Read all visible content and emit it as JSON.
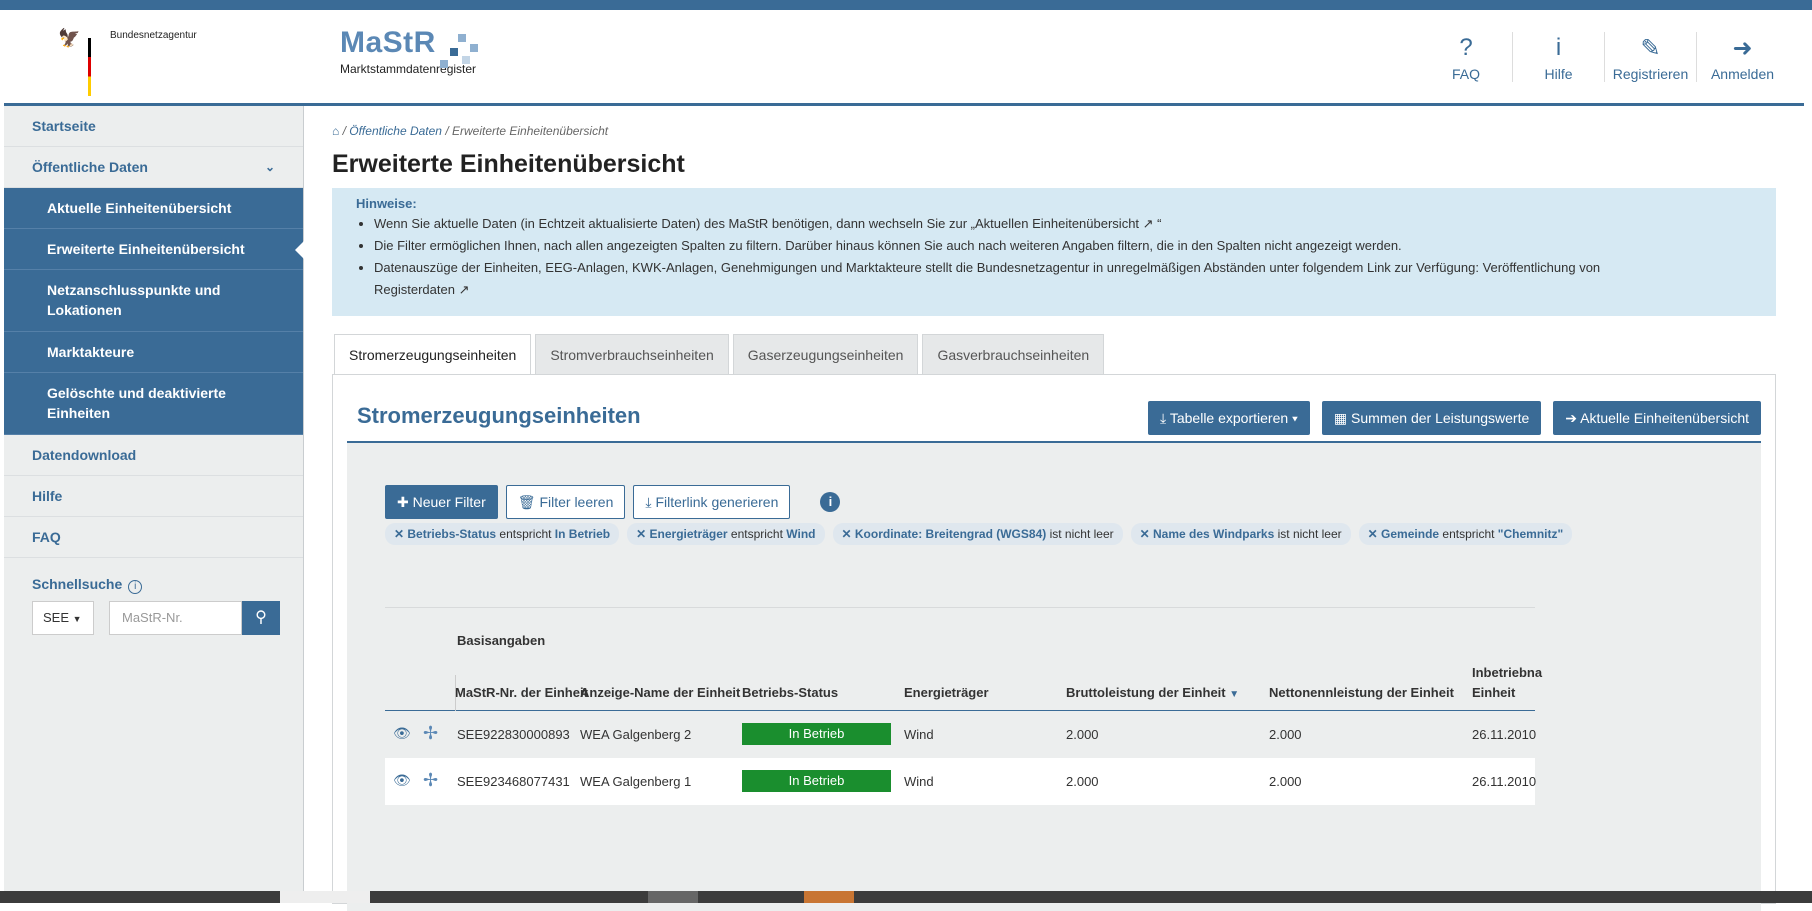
{
  "header": {
    "agency": "Bundesnetzagentur",
    "logo_title": "MaStR",
    "logo_sub": "Marktstammdatenregister",
    "nav": [
      {
        "icon": "question-circle-icon",
        "glyph": "?",
        "label": "FAQ"
      },
      {
        "icon": "info-circle-icon",
        "glyph": "i",
        "label": "Hilfe"
      },
      {
        "icon": "edit-icon",
        "glyph": "✎",
        "label": "Registrieren"
      },
      {
        "icon": "sign-in-icon",
        "glyph": "➜",
        "label": "Anmelden"
      }
    ]
  },
  "sidebar": {
    "items": [
      {
        "label": "Startseite"
      },
      {
        "label": "Öffentliche Daten"
      },
      {
        "label": "Aktuelle Einheitenübersicht"
      },
      {
        "label": "Erweiterte Einheitenübersicht"
      },
      {
        "label": "Netzanschlusspunkte und Lokationen"
      },
      {
        "label": "Marktakteure"
      },
      {
        "label": "Gelöschte und deaktivierte Einheiten"
      },
      {
        "label": "Datendownload"
      },
      {
        "label": "Hilfe"
      },
      {
        "label": "FAQ"
      }
    ],
    "quick_search_title": "Schnellsuche",
    "quick_select": "SEE",
    "quick_placeholder": "MaStR-Nr."
  },
  "breadcrumb": [
    "Öffentliche Daten",
    "Erweiterte Einheitenübersicht"
  ],
  "page_title": "Erweiterte Einheitenübersicht",
  "hints": {
    "title": "Hinweise:",
    "line1_pre": "Wenn Sie aktuelle Daten (in Echtzeit aktualisierte Daten) des MaStR benötigen, dann wechseln Sie zur ",
    "line1_link": "„Aktuellen Einheitenübersicht",
    "line1_post": " “",
    "line2": "Die Filter ermöglichen Ihnen, nach allen angezeigten Spalten zu filtern. Darüber hinaus können Sie auch nach weiteren Angaben filtern, die in den Spalten nicht angezeigt werden.",
    "line3_pre": "Datenauszüge der Einheiten, EEG-Anlagen, KWK-Anlagen, Genehmigungen und Marktakteure stellt die Bundesnetzagentur in unregelmäßigen Abständen unter folgendem Link zur Verfügung: ",
    "line3_link1": "Veröffentlichung von",
    "line3_link2": "Registerdaten"
  },
  "tabs": [
    "Stromerzeugungseinheiten",
    "Stromverbrauchseinheiten",
    "Gaserzeugungseinheiten",
    "Gasverbrauchseinheiten"
  ],
  "panel": {
    "title": "Stromerzeugungseinheiten",
    "export_label": "Tabelle exportieren",
    "sums_label": "Summen der Leistungswerte",
    "current_label": "Aktuelle Einheitenübersicht",
    "new_filter": "Neuer Filter",
    "clear_filter": "Filter leeren",
    "filter_link": "Filterlink generieren"
  },
  "filters": [
    {
      "field": "Betriebs-Status",
      "op": "entspricht",
      "value": "In Betrieb"
    },
    {
      "field": "Energieträger",
      "op": "entspricht",
      "value": "Wind"
    },
    {
      "field": "Koordinate: Breitengrad (WGS84)",
      "op": "ist nicht leer",
      "value": ""
    },
    {
      "field": "Name des Windparks",
      "op": "ist nicht leer",
      "value": ""
    },
    {
      "field": "Gemeinde",
      "op": "entspricht",
      "value": "\"Chemnitz\""
    }
  ],
  "table": {
    "group": "Basisangaben",
    "columns": [
      "MaStR-Nr. der Einheit",
      "Anzeige-Name der Einheit",
      "Betriebs-Status",
      "Energieträger",
      "Bruttoleistung der Einheit",
      "Nettonennleistung der Einheit",
      "Inbetriebna",
      "Einheit"
    ],
    "rows": [
      {
        "nr": "SEE922830000893",
        "name": "WEA Galgenberg 2",
        "status": "In Betrieb",
        "energy": "Wind",
        "brutto": "2.000",
        "netto": "2.000",
        "date": "26.11.2010"
      },
      {
        "nr": "SEE923468077431",
        "name": "WEA Galgenberg 1",
        "status": "In Betrieb",
        "energy": "Wind",
        "brutto": "2.000",
        "netto": "2.000",
        "date": "26.11.2010"
      }
    ]
  }
}
